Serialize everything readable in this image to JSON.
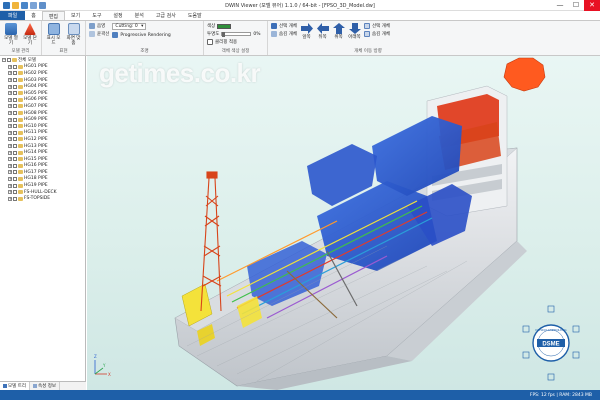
{
  "window": {
    "title": "DWIN Viewer (모델 뷰어) 1.1.0 / 64-bit - [FPSO_3D_Model.dw]",
    "minimize": "—",
    "maximize": "☐",
    "close": "✕"
  },
  "tabs": [
    "파일",
    "홈",
    "편집",
    "보기",
    "도구",
    "설정",
    "분석",
    "고급 검사",
    "도움말"
  ],
  "ribbon": {
    "groups": [
      {
        "label": "모델 관리",
        "buttons": [
          "모델 열기",
          "모델 닫기"
        ]
      },
      {
        "label": "표현",
        "buttons": [
          "표시 모드",
          "화면 맞춤"
        ]
      },
      {
        "label": "조명",
        "items": [
          "음영",
          "윤곽선"
        ],
        "combo": "Cutting: 0",
        "toggle": "Progressive Rendering"
      },
      {
        "label": "객체 색상 설정",
        "color_label": "색상",
        "color_value": "RGB (0, 255, ...)",
        "opacity_label": "투명도",
        "opacity_value": "0%",
        "checkbox": "클리핑 적용"
      },
      {
        "label": "개체 이동 방향",
        "items": [
          "선택 개체",
          "숨김 개체"
        ],
        "arrows": [
          "앞쪽",
          "뒤쪽",
          "위쪽",
          "아래쪽"
        ],
        "extra": [
          "선택 개체",
          "숨김 개체"
        ]
      }
    ]
  },
  "tree": {
    "root": "전체 모델",
    "items": [
      "HG01 PIPE",
      "HG02 PIPE",
      "HG03 PIPE",
      "HG04 PIPE",
      "HG05 PIPE",
      "HG06 PIPE",
      "HG07 PIPE",
      "HG08 PIPE",
      "HG09 PIPE",
      "HG10 PIPE",
      "HG11 PIPE",
      "HG12 PIPE",
      "HG13 PIPE",
      "HG14 PIPE",
      "HG15 PIPE",
      "HG16 PIPE",
      "HG17 PIPE",
      "HG18 PIPE",
      "HG19 PIPE",
      "FS-HULL-DECK",
      "FS-TOPSIDE"
    ]
  },
  "panel_tabs": [
    "모델 트리",
    "속성 정보"
  ],
  "watermark": "getimes.co.kr",
  "badge": {
    "text": "DSME",
    "ring_text": "DAEWOO SHIPBUILDING"
  },
  "axis": {
    "x": "X",
    "y": "Y",
    "z": "Z"
  },
  "status": "FPS: 12 fps | RAM: 2843 MB",
  "colors": {
    "accent": "#1e5fa8",
    "hull": "#e7e9ec",
    "deck_blue": "#2f5fd6",
    "tower_orange": "#d8441a",
    "flare_orange": "#ff5a1f",
    "pipe_yellow": "#f4e23a",
    "sea_bg": "#e9f6f4"
  }
}
